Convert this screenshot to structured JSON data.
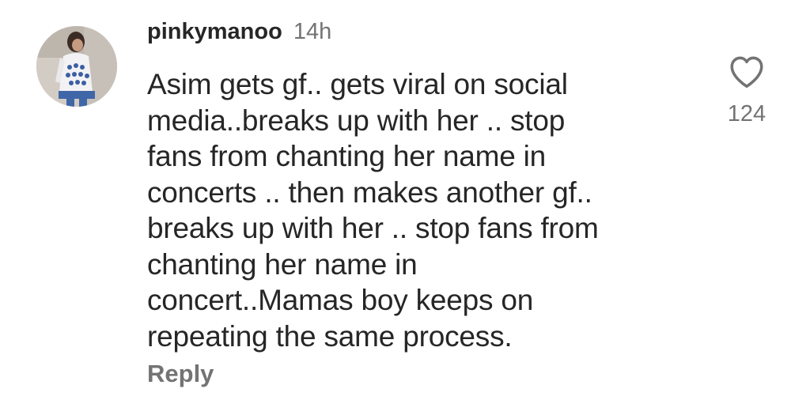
{
  "comment": {
    "username": "pinkymanoo",
    "timestamp": "14h",
    "body_lines": [
      "Asim gets gf.. gets viral on social",
      "media..breaks up with her .. stop",
      "fans from chanting her name in",
      "concerts .. then makes another gf..",
      "breaks up with her .. stop fans from",
      "chanting her name in",
      "concert..Mamas boy keeps on",
      "repeating the same process."
    ],
    "reply_label": "Reply",
    "like_count": "124",
    "like_icon": "heart-outline-icon"
  },
  "colors": {
    "primary_text": "#262626",
    "secondary_text": "#737373",
    "background": "#ffffff"
  }
}
